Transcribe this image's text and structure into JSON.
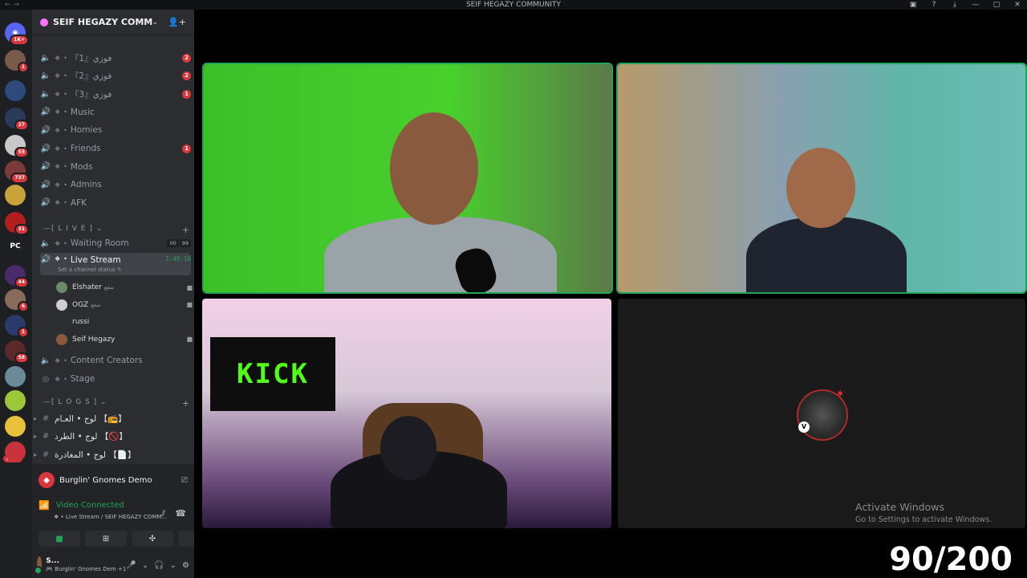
{
  "window": {
    "title": "SEIF HEGAZY COMMUNITY",
    "nav": "← →",
    "controls": [
      "▣",
      "?",
      "⤓",
      "—",
      "▢",
      "✕"
    ]
  },
  "guild_bar": {
    "items": [
      {
        "badge": "1K+",
        "color": "#5865f2",
        "glyph": "◉"
      },
      {
        "badge": "1",
        "color": "#7a5b4a",
        "glyph": ""
      },
      {
        "badge": "",
        "color": "#2d4a7a",
        "glyph": ""
      },
      {
        "badge": "27",
        "color": "#2a3a5a",
        "glyph": ""
      },
      {
        "badge": "55",
        "color": "#c8c8c8",
        "glyph": ""
      },
      {
        "badge": "737",
        "color": "#7a3a3a",
        "glyph": ""
      },
      {
        "badge": "",
        "color": "#c9a23a",
        "glyph": ""
      },
      {
        "badge": "31",
        "color": "#b21e1e",
        "glyph": ""
      },
      {
        "badge": "",
        "color": "#1e1f22",
        "glyph": "PC"
      },
      {
        "badge": "44",
        "color": "#4a2a6a",
        "glyph": ""
      },
      {
        "badge": "6",
        "color": "#8a6a5a",
        "glyph": ""
      },
      {
        "badge": "1",
        "color": "#2a3a6a",
        "glyph": ""
      },
      {
        "badge": "58",
        "color": "#5a2a2a",
        "glyph": ""
      },
      {
        "badge": "",
        "color": "#6a8a9a",
        "glyph": ""
      },
      {
        "badge": "",
        "color": "#9ac83a",
        "glyph": ""
      },
      {
        "badge": "",
        "color": "#e8c23a",
        "glyph": ""
      },
      {
        "badge": "",
        "color": "#c8323a",
        "glyph": ""
      }
    ],
    "new_label": "NEW"
  },
  "server": {
    "name": "SEIF HEGAZY COMMUNI...",
    "channels_top": [
      {
        "label": "『1』فوزي",
        "badge": "2"
      },
      {
        "label": "『2』فوزي",
        "badge": "2"
      },
      {
        "label": "『3』فوزي",
        "badge": "1"
      },
      {
        "label": "Music",
        "badge": ""
      },
      {
        "label": "Homies",
        "badge": ""
      },
      {
        "label": "Friends",
        "badge": "1"
      },
      {
        "label": "Mods",
        "badge": ""
      },
      {
        "label": "Admins",
        "badge": ""
      },
      {
        "label": "AFK",
        "badge": ""
      }
    ],
    "cat_live": "—[ L I V E ] ⌄",
    "waiting_room": {
      "label": "Waiting Room",
      "count_a": "00",
      "count_b": "99"
    },
    "live_stream": {
      "label": "Live Stream",
      "timer": "1:49:16",
      "status": "Set a channel status ✎"
    },
    "members": [
      {
        "name": "Elshater",
        "tag": "شغع",
        "color": "#6a8a6a",
        "cam": "■"
      },
      {
        "name": "OGZ",
        "tag": "شغع",
        "color": "#cfcfcf",
        "cam": "■"
      },
      {
        "name": "russi",
        "tag": "",
        "color": "#2b2d31",
        "cam": ""
      },
      {
        "name": "Seif Hegazy",
        "tag": "",
        "color": "#8b5a3c",
        "cam": "■"
      }
    ],
    "content_creators": "Content Creators",
    "stage": "Stage",
    "cat_logs": "—[ L O G S ] ⌄",
    "logs": [
      {
        "label": "لوج • العـام 【📻】"
      },
      {
        "label": "لوج • الطرد 【🚫】"
      },
      {
        "label": "لوج • المغادرة 【📄】"
      }
    ]
  },
  "activity": {
    "game": "Burglin' Gnomes Demo"
  },
  "voice": {
    "status": "Video Connected",
    "location": "❖ • Live Stream / SEIF HEGAZY COMM...",
    "buttons": [
      "■",
      "⊞",
      "✣",
      "✺"
    ]
  },
  "user_panel": {
    "name": "S...",
    "status": "🎮 Burglin' Gnomes Dem +1",
    "icons": [
      "🎤",
      "⌄",
      "🎧",
      "⌄",
      "⚙"
    ]
  },
  "overlay": {
    "watermark_line1": "Activate Windows",
    "watermark_line2": "Go to Settings to activate Windows.",
    "counter": "90/200",
    "kick_text": "KICK"
  }
}
